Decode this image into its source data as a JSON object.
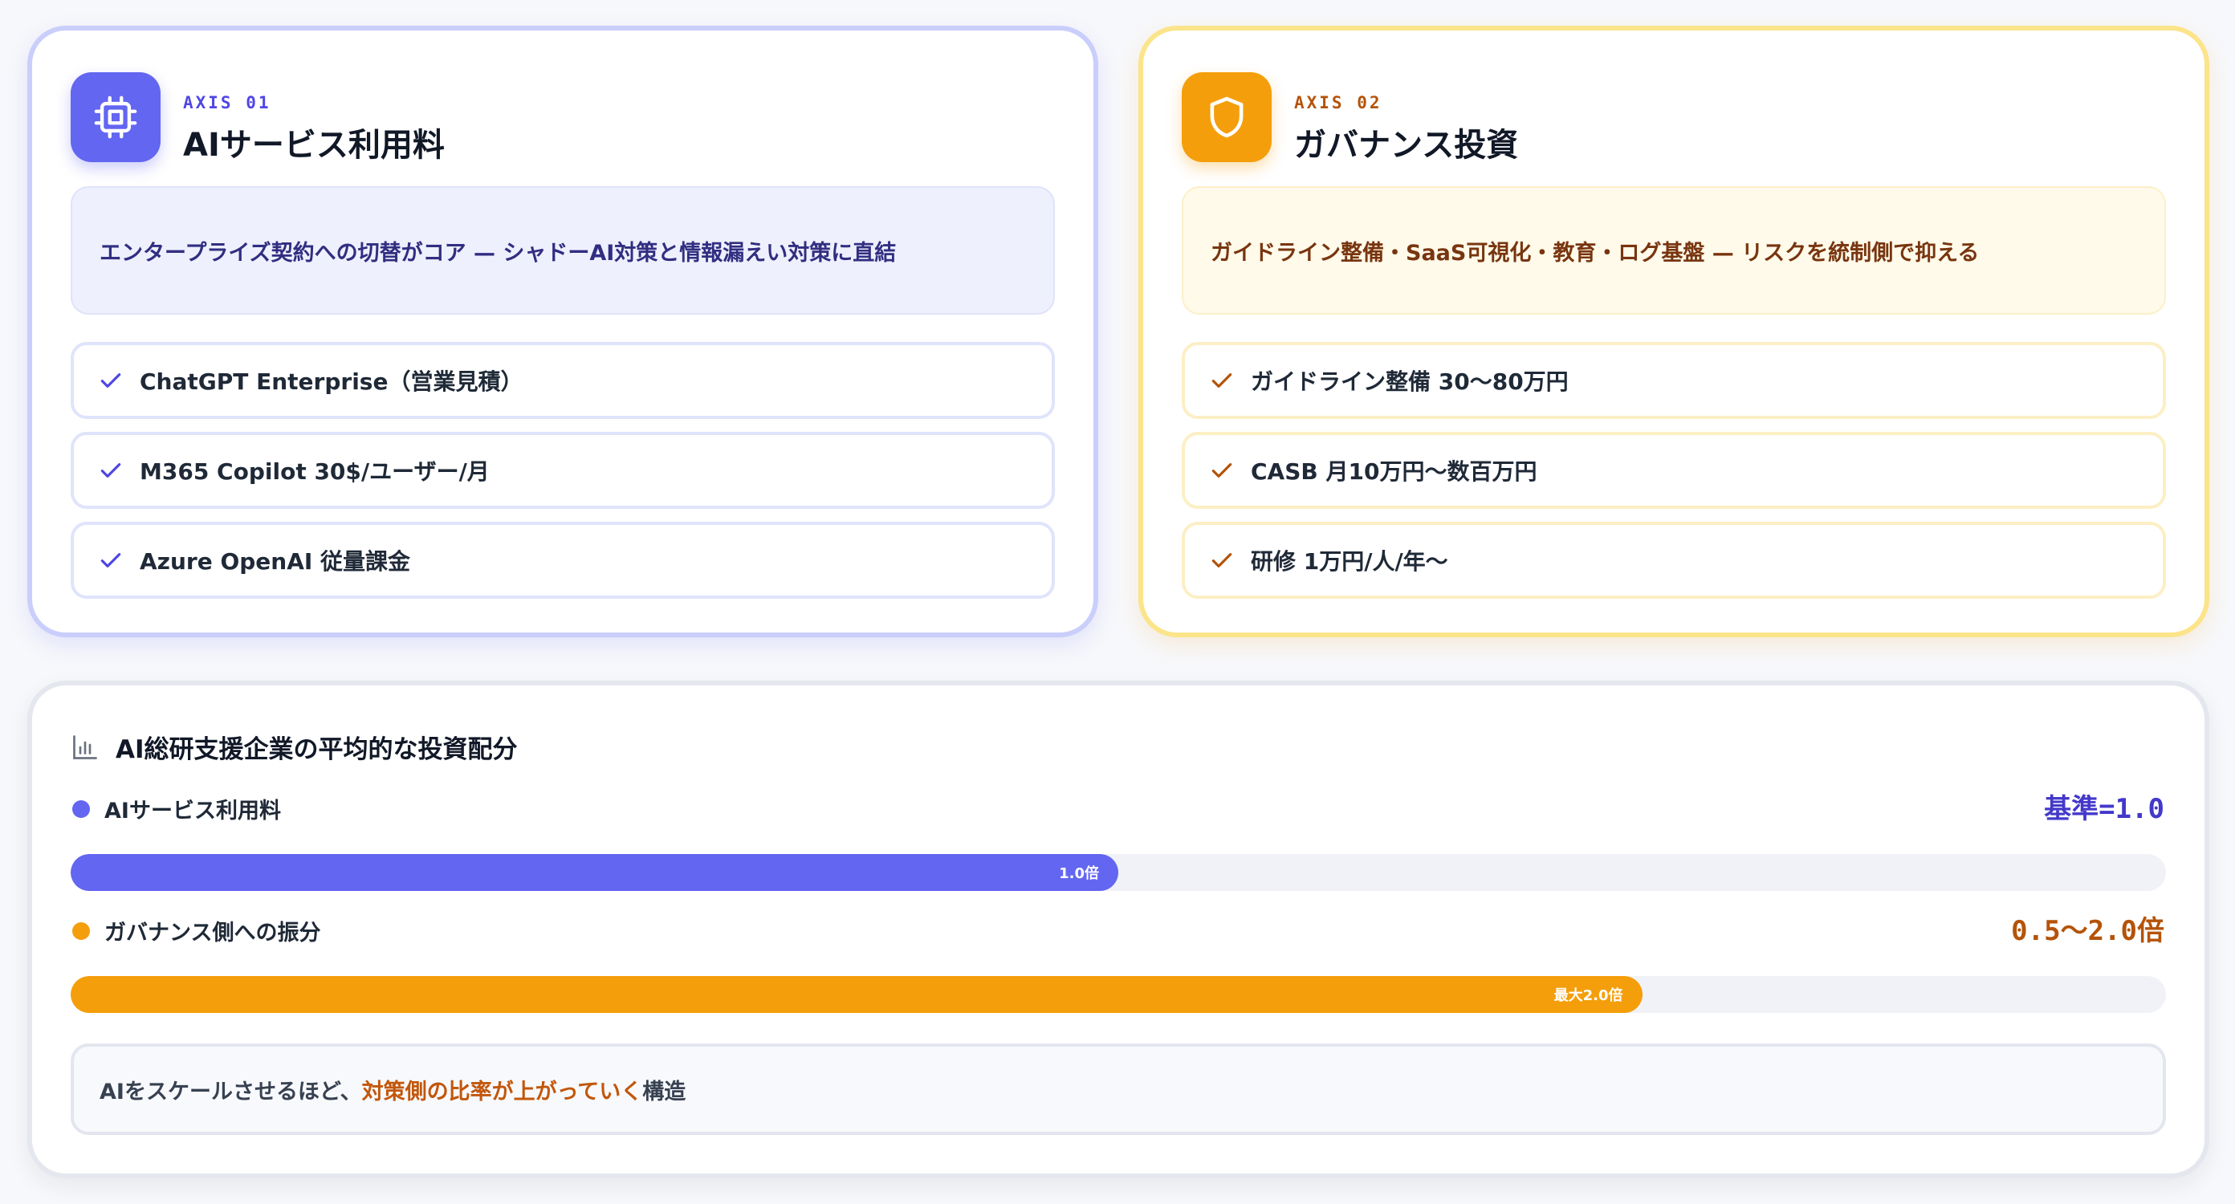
{
  "cards": {
    "ai": {
      "axis": "AXIS 01",
      "title": "AIサービス利用料",
      "icon": "chip-icon",
      "summary": "エンタープライズ契約への切替がコア — シャドーAI対策と情報漏えい対策に直結",
      "items": [
        "ChatGPT Enterprise（営業見積）",
        "M365 Copilot 30$/ユーザー/月",
        "Azure OpenAI 従量課金"
      ]
    },
    "gov": {
      "axis": "AXIS 02",
      "title": "ガバナンス投資",
      "icon": "shield-icon",
      "summary": "ガイドライン整備・SaaS可視化・教育・ログ基盤 — リスクを統制側で抑える",
      "items": [
        "ガイドライン整備 30〜80万円",
        "CASB 月10万円〜数百万円",
        "研修 1万円/人/年〜"
      ]
    }
  },
  "allocation": {
    "title": "AI総研支援企業の平均的な投資配分",
    "icon": "bar-chart-icon",
    "bars": [
      {
        "label": "AIサービス利用料",
        "value_text": "基準=1.0",
        "fill_text": "1.0倍",
        "fill_fraction": 0.5
      },
      {
        "label": "ガバナンス側への振分",
        "value_text": "0.5〜2.0倍",
        "fill_text": "最大2.0倍",
        "fill_fraction": 0.75
      }
    ],
    "note": {
      "before": "AIをスケールさせるほど、",
      "highlight": "対策側の比率が上がっていく",
      "after": "構造"
    }
  },
  "colors": {
    "ai_accent": "#6366f1",
    "gov_accent": "#f59e0b",
    "highlight": "#c2570c"
  }
}
